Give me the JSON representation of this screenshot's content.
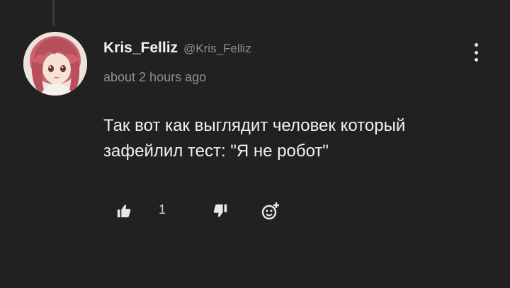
{
  "comment": {
    "author": "Kris_Felliz",
    "handle": "@Kris_Felliz",
    "timestamp": "about 2 hours ago",
    "text": "Так вот как выглядит человек который зафейлил тест: \"Я не робот\"",
    "likes": "1",
    "icons": {
      "menu": "more-vertical-icon",
      "like": "thumbs-up-icon",
      "dislike": "thumbs-down-icon",
      "reaction": "add-reaction-icon"
    }
  },
  "colors": {
    "background": "#212121",
    "primary_text": "#f1f1f1",
    "secondary_text": "#8f8f8f"
  }
}
